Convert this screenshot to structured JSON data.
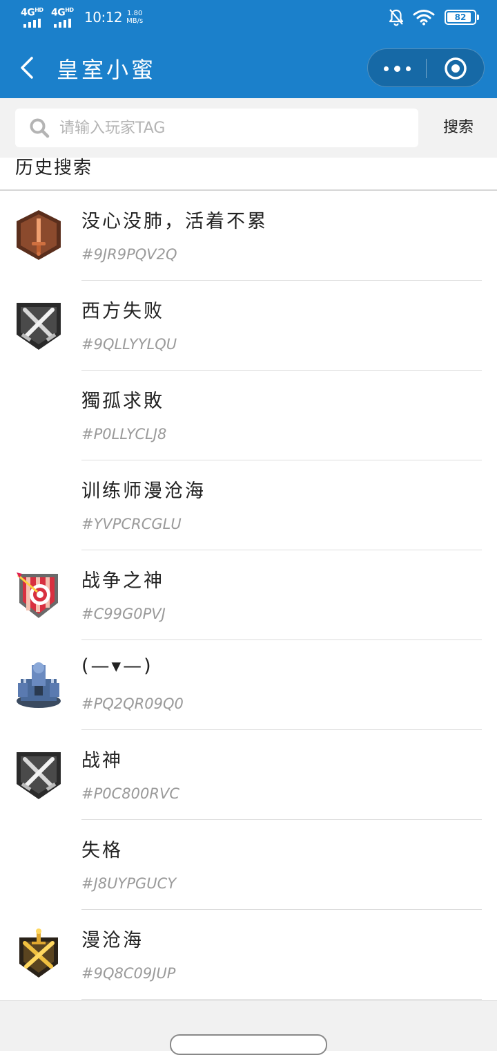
{
  "status_bar": {
    "network1": "4G",
    "network1_sup": "HD",
    "network2": "4G",
    "network2_sup": "HD",
    "time": "10:12",
    "speed_value": "1.80",
    "speed_unit": "MB/s",
    "battery": "82",
    "icons": [
      "signal-icon",
      "signal-icon",
      "bell-off-icon",
      "wifi-icon",
      "battery-icon"
    ]
  },
  "nav": {
    "title": "皇室小蜜",
    "back_icon": "chevron-left-icon",
    "more_icon": "more-dots-icon",
    "close_icon": "target-circle-icon",
    "background": "#1b80cb"
  },
  "search": {
    "placeholder": "请输入玩家TAG",
    "value": "",
    "button_label": "搜索",
    "icon": "search-icon"
  },
  "history": {
    "header": "历史搜索",
    "items": [
      {
        "name": "没心没肺，活着不累",
        "tag": "#9JR9PQV2Q",
        "badge": "bronze-sword-icon"
      },
      {
        "name": "西方失败",
        "tag": "#9QLLYYLQU",
        "badge": "silver-crossed-swords-icon"
      },
      {
        "name": "獨孤求敗",
        "tag": "#P0LLYCLJ8",
        "badge": ""
      },
      {
        "name": "训练师漫沧海",
        "tag": "#YVPCRCGLU",
        "badge": ""
      },
      {
        "name": "战争之神",
        "tag": "#C99G0PVJ",
        "badge": "target-shield-icon"
      },
      {
        "name": "(—▾—)",
        "tag": "#PQ2QR09Q0",
        "badge": "arena-icon"
      },
      {
        "name": "战神",
        "tag": "#P0C800RVC",
        "badge": "silver-crossed-swords-icon"
      },
      {
        "name": "失格",
        "tag": "#J8UYPGUCY",
        "badge": ""
      },
      {
        "name": "漫沧海",
        "tag": "#9Q8C09JUP",
        "badge": "gold-crossed-swords-icon"
      }
    ]
  }
}
